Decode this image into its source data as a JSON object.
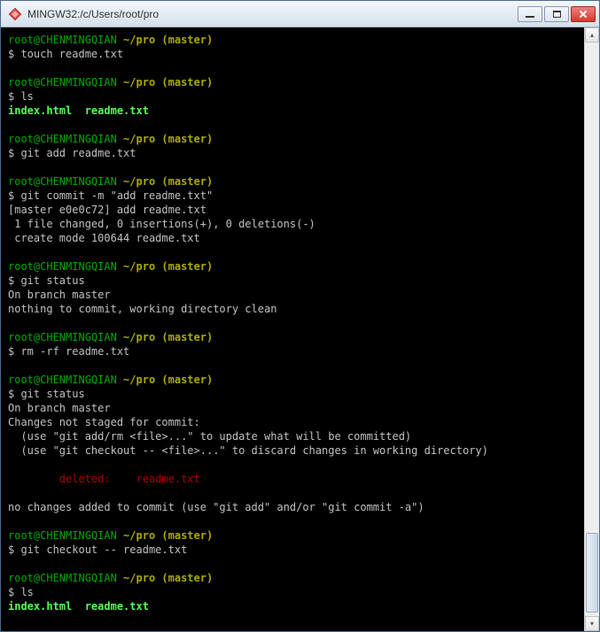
{
  "window": {
    "title": "MINGW32:/c/Users/root/pro"
  },
  "colors": {
    "prompt_user": "#00aa00",
    "prompt_branch": "#aaaa00",
    "command": "#c0c0c0",
    "output": "#55ff55",
    "deleted": "#aa0000"
  },
  "prompt": {
    "userhost": "root@CHENMINGQIAN",
    "path": "~/pro",
    "branch": "(master)",
    "symbol": "$"
  },
  "blocks": [
    {
      "cmd": "touch readme.txt",
      "out": []
    },
    {
      "cmd": "ls",
      "out": [
        {
          "text": "index.html  readme.txt",
          "class": "bg"
        }
      ]
    },
    {
      "cmd": "git add readme.txt",
      "out": []
    },
    {
      "cmd": "git commit -m \"add readme.txt\"",
      "out": [
        {
          "text": "[master e0e0c72] add readme.txt",
          "class": "w"
        },
        {
          "text": " 1 file changed, 0 insertions(+), 0 deletions(-)",
          "class": "w"
        },
        {
          "text": " create mode 100644 readme.txt",
          "class": "w"
        }
      ]
    },
    {
      "cmd": "git status",
      "out": [
        {
          "text": "On branch master",
          "class": "w"
        },
        {
          "text": "nothing to commit, working directory clean",
          "class": "w"
        }
      ]
    },
    {
      "cmd": "rm -rf readme.txt",
      "out": []
    },
    {
      "cmd": "git status",
      "out": [
        {
          "text": "On branch master",
          "class": "w"
        },
        {
          "text": "Changes not staged for commit:",
          "class": "w"
        },
        {
          "text": "  (use \"git add/rm <file>...\" to update what will be committed)",
          "class": "w"
        },
        {
          "text": "  (use \"git checkout -- <file>...\" to discard changes in working directory)",
          "class": "w"
        },
        {
          "text": "",
          "class": "w"
        },
        {
          "text": "        deleted:    readme.txt",
          "class": "r"
        },
        {
          "text": "",
          "class": "w"
        },
        {
          "text": "no changes added to commit (use \"git add\" and/or \"git commit -a\")",
          "class": "w"
        }
      ]
    },
    {
      "cmd": "git checkout -- readme.txt",
      "out": []
    },
    {
      "cmd": "ls",
      "out": [
        {
          "text": "index.html  readme.txt",
          "class": "bg"
        }
      ]
    }
  ]
}
